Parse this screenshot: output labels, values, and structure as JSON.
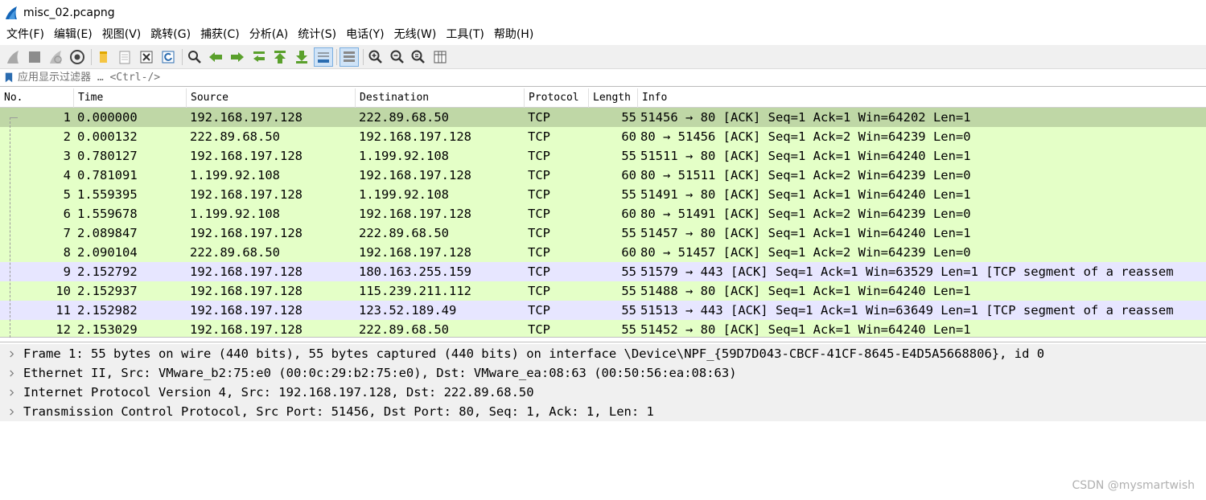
{
  "window": {
    "title": "misc_02.pcapng"
  },
  "menu": {
    "items": [
      "文件(F)",
      "编辑(E)",
      "视图(V)",
      "跳转(G)",
      "捕获(C)",
      "分析(A)",
      "统计(S)",
      "电话(Y)",
      "无线(W)",
      "工具(T)",
      "帮助(H)"
    ]
  },
  "toolbar": {
    "icons": [
      "shark-fin-start-icon",
      "stop-icon",
      "restart-icon",
      "options-gear-icon",
      "open-file-icon",
      "file-set-icon",
      "close-file-icon",
      "reload-icon",
      "find-icon",
      "back-arrow-icon",
      "forward-arrow-icon",
      "go-to-packet-icon",
      "first-packet-icon",
      "last-packet-icon",
      "autoscroll-icon",
      "colorize-icon",
      "zoom-in-icon",
      "zoom-out-icon",
      "zoom-normal-icon",
      "resize-columns-icon"
    ]
  },
  "filter": {
    "placeholder": "应用显示过滤器 … <Ctrl-/>"
  },
  "packet_list": {
    "columns": [
      "No.",
      "Time",
      "Source",
      "Destination",
      "Protocol",
      "Length",
      "Info"
    ],
    "rows": [
      {
        "no": "1",
        "time": "0.000000",
        "source": "192.168.197.128",
        "destination": "222.89.68.50",
        "protocol": "TCP",
        "length": "55",
        "info": "51456 → 80 [ACK] Seq=1 Ack=1 Win=64202 Len=1",
        "color": "#bfd7a6",
        "selected": true
      },
      {
        "no": "2",
        "time": "0.000132",
        "source": "222.89.68.50",
        "destination": "192.168.197.128",
        "protocol": "TCP",
        "length": "60",
        "info": "80 → 51456 [ACK] Seq=1 Ack=2 Win=64239 Len=0",
        "color": "#e4ffc7"
      },
      {
        "no": "3",
        "time": "0.780127",
        "source": "192.168.197.128",
        "destination": "1.199.92.108",
        "protocol": "TCP",
        "length": "55",
        "info": "51511 → 80 [ACK] Seq=1 Ack=1 Win=64240 Len=1",
        "color": "#e4ffc7"
      },
      {
        "no": "4",
        "time": "0.781091",
        "source": "1.199.92.108",
        "destination": "192.168.197.128",
        "protocol": "TCP",
        "length": "60",
        "info": "80 → 51511 [ACK] Seq=1 Ack=2 Win=64239 Len=0",
        "color": "#e4ffc7"
      },
      {
        "no": "5",
        "time": "1.559395",
        "source": "192.168.197.128",
        "destination": "1.199.92.108",
        "protocol": "TCP",
        "length": "55",
        "info": "51491 → 80 [ACK] Seq=1 Ack=1 Win=64240 Len=1",
        "color": "#e4ffc7"
      },
      {
        "no": "6",
        "time": "1.559678",
        "source": "1.199.92.108",
        "destination": "192.168.197.128",
        "protocol": "TCP",
        "length": "60",
        "info": "80 → 51491 [ACK] Seq=1 Ack=2 Win=64239 Len=0",
        "color": "#e4ffc7"
      },
      {
        "no": "7",
        "time": "2.089847",
        "source": "192.168.197.128",
        "destination": "222.89.68.50",
        "protocol": "TCP",
        "length": "55",
        "info": "51457 → 80 [ACK] Seq=1 Ack=1 Win=64240 Len=1",
        "color": "#e4ffc7"
      },
      {
        "no": "8",
        "time": "2.090104",
        "source": "222.89.68.50",
        "destination": "192.168.197.128",
        "protocol": "TCP",
        "length": "60",
        "info": "80 → 51457 [ACK] Seq=1 Ack=2 Win=64239 Len=0",
        "color": "#e4ffc7"
      },
      {
        "no": "9",
        "time": "2.152792",
        "source": "192.168.197.128",
        "destination": "180.163.255.159",
        "protocol": "TCP",
        "length": "55",
        "info": "51579 → 443 [ACK] Seq=1 Ack=1 Win=63529 Len=1 [TCP segment of a reassem",
        "color": "#e7e6ff"
      },
      {
        "no": "10",
        "time": "2.152937",
        "source": "192.168.197.128",
        "destination": "115.239.211.112",
        "protocol": "TCP",
        "length": "55",
        "info": "51488 → 80 [ACK] Seq=1 Ack=1 Win=64240 Len=1",
        "color": "#e4ffc7"
      },
      {
        "no": "11",
        "time": "2.152982",
        "source": "192.168.197.128",
        "destination": "123.52.189.49",
        "protocol": "TCP",
        "length": "55",
        "info": "51513 → 443 [ACK] Seq=1 Ack=1 Win=63649 Len=1 [TCP segment of a reassem",
        "color": "#e7e6ff"
      },
      {
        "no": "12",
        "time": "2.153029",
        "source": "192.168.197.128",
        "destination": "222.89.68.50",
        "protocol": "TCP",
        "length": "55",
        "info": "51452 → 80 [ACK] Seq=1 Ack=1 Win=64240 Len=1",
        "color": "#e4ffc7"
      }
    ]
  },
  "details": {
    "rows": [
      "Frame 1: 55 bytes on wire (440 bits), 55 bytes captured (440 bits) on interface \\Device\\NPF_{59D7D043-CBCF-41CF-8645-E4D5A5668806}, id 0",
      "Ethernet II, Src: VMware_b2:75:e0 (00:0c:29:b2:75:e0), Dst: VMware_ea:08:63 (00:50:56:ea:08:63)",
      "Internet Protocol Version 4, Src: 192.168.197.128, Dst: 222.89.68.50",
      "Transmission Control Protocol, Src Port: 51456, Dst Port: 80, Seq: 1, Ack: 1, Len: 1"
    ]
  },
  "watermark": "CSDN @mysmartwish",
  "colors": {
    "selected_row": "#bfd7a6",
    "tcp_row": "#e4ffc7",
    "reassembled_row": "#e7e6ff",
    "detail_bg": "#f0f0f0"
  }
}
